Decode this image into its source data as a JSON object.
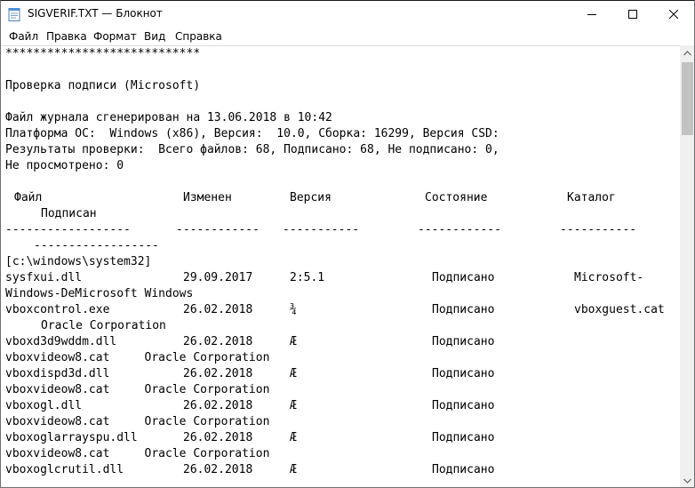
{
  "window": {
    "title": "SIGVERIF.TXT — Блокнот"
  },
  "menu": [
    "Файл",
    "Правка",
    "Формат",
    "Вид",
    "Справка"
  ],
  "text_lines": [
    "****************************",
    "",
    "Проверка подписи (Microsoft)",
    "",
    "Файл журнала сгенерирован на 13.06.2018 в 10:42",
    "Платформа ОС:  Windows (x86), Версия:  10.0, Сборка: 16299, Версия CSD:",
    "Результаты проверки:  Всего файлов: 68, Подписано: 68, Не подписано: 0,",
    "Не просмотрено: 0"
  ],
  "table": {
    "headers": [
      "Файл",
      "Изменен",
      "Версия",
      "Состояние",
      "Каталог"
    ],
    "header_wrap": "Подписан",
    "header_rule": [
      "------------------",
      "------------",
      "-----------",
      "------------",
      "-----------"
    ],
    "header_rule_wrap": "------------------",
    "folder": "[c:\\windows\\system32]",
    "rows": [
      {
        "file": "sysfxui.dll",
        "date": "29.09.2017",
        "version": "2:5.1",
        "status": "Подписано",
        "catalog": "Microsoft-",
        "wrap": "Windows-DeMicrosoft Windows"
      },
      {
        "file": "vboxcontrol.exe",
        "date": "26.02.2018",
        "version": "¾",
        "status": "Подписано",
        "catalog": "vboxguest.cat",
        "wrap": "Oracle Corporation"
      },
      {
        "file": "vboxd3d9wddm.dll",
        "date": "26.02.2018",
        "version": "Æ",
        "status": "Подписано",
        "catalog": "",
        "wrap": "vboxvideow8.cat     Oracle Corporation"
      },
      {
        "file": "vboxdispd3d.dll",
        "date": "26.02.2018",
        "version": "Æ",
        "status": "Подписано",
        "catalog": "",
        "wrap": "vboxvideow8.cat     Oracle Corporation"
      },
      {
        "file": "vboxogl.dll",
        "date": "26.02.2018",
        "version": "Æ",
        "status": "Подписано",
        "catalog": "",
        "wrap": "vboxvideow8.cat     Oracle Corporation"
      },
      {
        "file": "vboxoglarrayspu.dll",
        "date": "26.02.2018",
        "version": "Æ",
        "status": "Подписано",
        "catalog": "",
        "wrap": "vboxvideow8.cat     Oracle Corporation"
      },
      {
        "file": "vboxoglcrutil.dll",
        "date": "26.02.2018",
        "version": "Æ",
        "status": "Подписано",
        "catalog": "",
        "wrap": ""
      }
    ]
  },
  "icons": {
    "app": "notepad-icon",
    "minimize": "minimize-icon",
    "maximize": "maximize-icon",
    "close": "close-icon",
    "scroll_up": "scroll-up-arrow-icon",
    "scroll_down": "scroll-down-arrow-icon"
  },
  "colors": {
    "background": "#ffffff",
    "text": "#000000",
    "scrollbar": "#f0f0f0",
    "thumb": "#c2c2c2"
  }
}
